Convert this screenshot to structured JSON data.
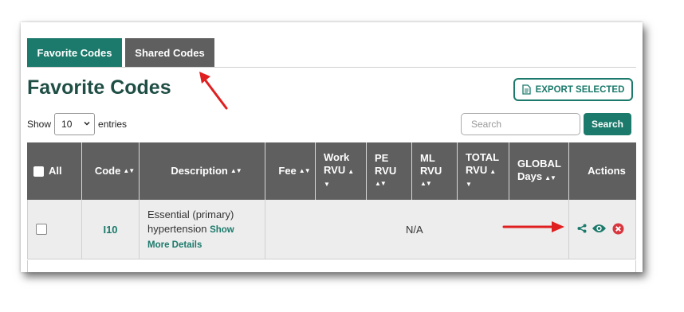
{
  "tabs": [
    {
      "label": "Favorite Codes",
      "active": true
    },
    {
      "label": "Shared Codes",
      "active": false
    }
  ],
  "page_title": "Favorite Codes",
  "export_label": "EXPORT SELECTED",
  "length": {
    "prefix": "Show",
    "value": "10",
    "suffix": "entries"
  },
  "search": {
    "placeholder": "Search",
    "button": "Search"
  },
  "table": {
    "headers": {
      "all": "All",
      "code": "Code",
      "description": "Description",
      "fee": "Fee",
      "work_rvu_1": "Work",
      "work_rvu_2": "RVU",
      "pe_rvu_1": "PE",
      "pe_rvu_2": "RVU",
      "ml_rvu_1": "ML",
      "ml_rvu_2": "RVU",
      "total_rvu_1": "TOTAL",
      "total_rvu_2": "RVU",
      "global_1": "GLOBAL",
      "global_2": "Days",
      "actions": "Actions"
    },
    "rows": [
      {
        "code": "I10",
        "description": "Essential (primary) hypertension",
        "show_more": "Show",
        "more_details": "More Details",
        "rvu": "N/A"
      }
    ]
  },
  "colors": {
    "accent": "#1b7a6b",
    "tab_inactive": "#5f5f5f",
    "header_bg": "#5f5f5f",
    "row_bg": "#ededed",
    "annotation": "#e02020",
    "delete": "#d9363e"
  },
  "icons": [
    "export-document-icon",
    "select-chevron-icon",
    "sort-arrows-icon",
    "share-icon",
    "view-eye-icon",
    "delete-circle-x-icon",
    "annotation-arrow"
  ]
}
